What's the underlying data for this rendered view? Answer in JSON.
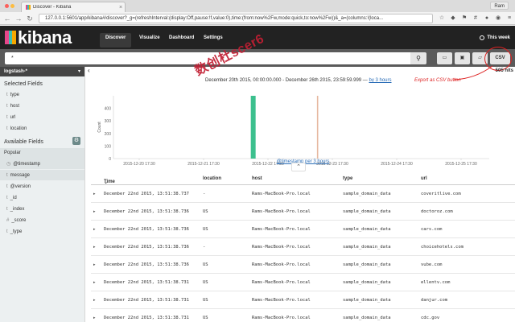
{
  "browser": {
    "tab_title": "Discover - Kibana",
    "tab_close": "×",
    "url": "127.0.0.1:5601/app/kibana#/discover?_g=(refreshInterval:(display:Off,pause:!f,value:0),time:(from:now%2Fw,mode:quick,to:now%2Fw))&_a=(columns:!(loca...",
    "profile": "Ram",
    "back": "←",
    "forward": "→",
    "reload": "↻"
  },
  "kibana": {
    "logo": "kibana",
    "tabs": [
      "Discover",
      "Visualize",
      "Dashboard",
      "Settings"
    ],
    "time_filter": "This week",
    "search_value": "*",
    "csv_label": "CSV",
    "hits": "505 hits",
    "range_text": "December 20th 2015, 00:00:00.000 - December 26th 2015, 23:59:59.999 —",
    "range_link": "by 3 hours",
    "annotation": "Export as CSV button",
    "watermark": "数创杜scer6",
    "chart_caption": "@timestamp per 3 hours"
  },
  "sidebar": {
    "index_pattern": "logstash-*",
    "selected_heading": "Selected Fields",
    "selected_fields": [
      {
        "type": "t",
        "name": "type"
      },
      {
        "type": "t",
        "name": "host"
      },
      {
        "type": "t",
        "name": "url"
      },
      {
        "type": "t",
        "name": "location"
      }
    ],
    "available_heading": "Available Fields",
    "popular_label": "Popular",
    "popular_fields": [
      {
        "type": "◷",
        "name": "@timestamp"
      },
      {
        "type": "t",
        "name": "message"
      }
    ],
    "other_fields": [
      {
        "type": "t",
        "name": "@version"
      },
      {
        "type": "t",
        "name": "_id"
      },
      {
        "type": "t",
        "name": "_index"
      },
      {
        "type": "#",
        "name": "_score"
      },
      {
        "type": "t",
        "name": "_type"
      }
    ]
  },
  "chart_data": {
    "type": "bar",
    "title": "",
    "xlabel": "@timestamp per 3 hours",
    "ylabel": "Count",
    "ylim": [
      0,
      500
    ],
    "yticks": [
      0,
      100,
      200,
      300,
      400
    ],
    "xticks": [
      "2015-12-20 17:30",
      "2015-12-21 17:30",
      "2015-12-22 17:30",
      "2015-12-23 17:30",
      "2015-12-24 17:30",
      "2015-12-25 17:30"
    ],
    "bars": [
      {
        "x": "2015-12-22 12:00",
        "value": 500,
        "color": "#3cc08e"
      },
      {
        "x": "2015-12-23 12:00",
        "value": 500,
        "color": "#e6b8a0"
      }
    ]
  },
  "table": {
    "headers": [
      "Time",
      "location",
      "host",
      "type",
      "url"
    ],
    "sort_indicator": "⌄",
    "rows": [
      [
        "December 22nd 2015, 13:51:38.737",
        "-",
        "Rams-MacBook-Pro.local",
        "sample_domain_data",
        "coveritlive.com"
      ],
      [
        "December 22nd 2015, 13:51:38.736",
        "US",
        "Rams-MacBook-Pro.local",
        "sample_domain_data",
        "doctoroz.com"
      ],
      [
        "December 22nd 2015, 13:51:38.736",
        "US",
        "Rams-MacBook-Pro.local",
        "sample_domain_data",
        "cars.com"
      ],
      [
        "December 22nd 2015, 13:51:38.736",
        "-",
        "Rams-MacBook-Pro.local",
        "sample_domain_data",
        "choicehotels.com"
      ],
      [
        "December 22nd 2015, 13:51:38.736",
        "US",
        "Rams-MacBook-Pro.local",
        "sample_domain_data",
        "vube.com"
      ],
      [
        "December 22nd 2015, 13:51:38.731",
        "US",
        "Rams-MacBook-Pro.local",
        "sample_domain_data",
        "ellentv.com"
      ],
      [
        "December 22nd 2015, 13:51:38.731",
        "US",
        "Rams-MacBook-Pro.local",
        "sample_domain_data",
        "danjur.com"
      ],
      [
        "December 22nd 2015, 13:51:38.731",
        "US",
        "Rams-MacBook-Pro.local",
        "sample_domain_data",
        "cdc.gov"
      ]
    ]
  }
}
